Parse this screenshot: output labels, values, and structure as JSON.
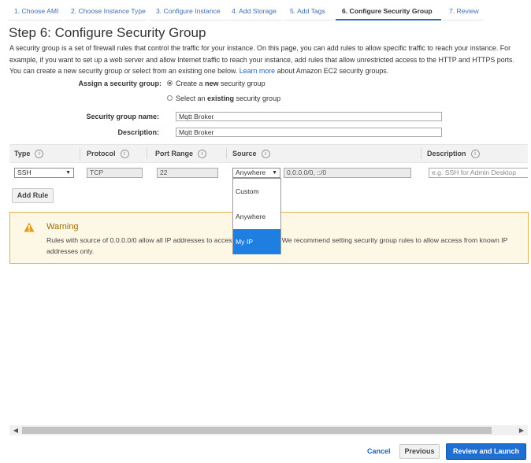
{
  "wizard": {
    "steps": [
      "1. Choose AMI",
      "2. Choose Instance Type",
      "3. Configure Instance",
      "4. Add Storage",
      "5. Add Tags",
      "6. Configure Security Group",
      "7. Review"
    ]
  },
  "page": {
    "title": "Step 6: Configure Security Group",
    "intro_text": "A security group is a set of firewall rules that control the traffic for your instance. On this page, you can add rules to allow specific traffic to reach your instance. For example, if you want to set up a web server and allow Internet traffic to reach your instance, add rules that allow unrestricted access to the HTTP and HTTPS ports. You can create a new security group or select from an existing one below.",
    "learn_more": "Learn more",
    "intro_tail": "about Amazon EC2 security groups."
  },
  "assign": {
    "label": "Assign a security group:",
    "option_new_pre": "Create a ",
    "option_new_bold": "new",
    "option_new_post": " security group",
    "option_existing_pre": "Select an ",
    "option_existing_bold": "existing",
    "option_existing_post": " security group",
    "selected": "new"
  },
  "form": {
    "name_label": "Security group name:",
    "name_value": "Mqtt Broker",
    "desc_label": "Description:",
    "desc_value": "Mqtt Broker"
  },
  "table": {
    "headers": [
      "Type",
      "Protocol",
      "Port Range",
      "Source",
      "Description"
    ],
    "row": {
      "type": "SSH",
      "protocol": "TCP",
      "port_range": "22",
      "source": "Anywhere",
      "cidr": "0.0.0.0/0, ::/0",
      "description_placeholder": "e.g. SSH for Admin Desktop"
    }
  },
  "source_dropdown": {
    "options": [
      "Custom",
      "Anywhere",
      "My IP"
    ],
    "highlighted": "My IP"
  },
  "add_rule_label": "Add Rule",
  "warning": {
    "title": "Warning",
    "text": "Rules with source of 0.0.0.0/0 allow all IP addresses to access your instance. We recommend setting security group rules to allow access from known IP addresses only."
  },
  "footer": {
    "cancel": "Cancel",
    "previous": "Previous",
    "review_launch": "Review and Launch"
  },
  "colors": {
    "accent": "#1f6fd1",
    "link": "#1a63c1",
    "warning_border": "#e3b04b",
    "dropdown_highlight": "#1e7fe0"
  }
}
